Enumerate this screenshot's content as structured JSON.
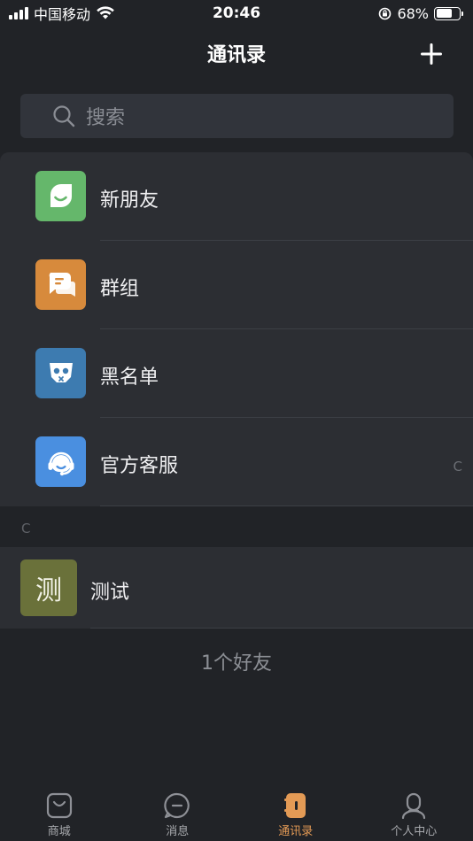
{
  "status_bar": {
    "carrier": "中国移动",
    "time": "20:46",
    "battery": "68%",
    "battery_level": 0.68
  },
  "header": {
    "title": "通讯录",
    "add_icon": "plus-icon"
  },
  "search": {
    "placeholder": "搜索",
    "icon": "search-icon"
  },
  "menu": {
    "items": [
      {
        "label": "新朋友",
        "icon": "smile-leaf-icon",
        "color": "#65b76b"
      },
      {
        "label": "群组",
        "icon": "chat-bubbles-icon",
        "color": "#d78a3c"
      },
      {
        "label": "黑名单",
        "icon": "skull-icon",
        "color": "#3d7bb0"
      },
      {
        "label": "官方客服",
        "icon": "headset-icon",
        "color": "#4a8fe0"
      }
    ]
  },
  "index": {
    "right_letter": "C",
    "section_letter": "C"
  },
  "contacts": [
    {
      "avatar_text": "测",
      "name": "测试",
      "avatar_color": "#6a713a"
    }
  ],
  "friend_count": "1个好友",
  "tabs": [
    {
      "label": "商城",
      "icon": "shop-bag-icon",
      "active": false
    },
    {
      "label": "消息",
      "icon": "message-icon",
      "active": false
    },
    {
      "label": "通讯录",
      "icon": "contacts-book-icon",
      "active": true
    },
    {
      "label": "个人中心",
      "icon": "person-icon",
      "active": false
    }
  ],
  "colors": {
    "background": "#212327",
    "panel": "#2c2e33",
    "accent": "#e39a55"
  }
}
